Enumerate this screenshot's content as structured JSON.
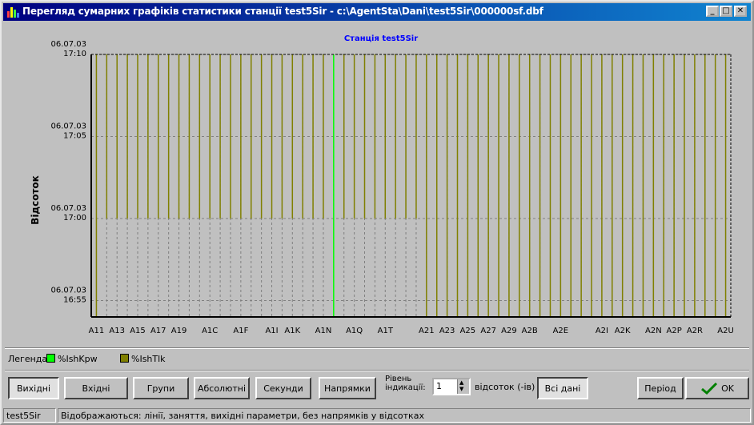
{
  "window": {
    "title": "Перегляд сумарних графіків статистики станції test5Sir - c:\\AgentSta\\Dani\\test5Sir\\000000sf.dbf",
    "controls": [
      "minimize-icon",
      "maximize-icon",
      "close-icon"
    ]
  },
  "chart_data": {
    "type": "bar",
    "title": "Станція test5Sir",
    "ylabel": "Відсоток",
    "xlabel": "",
    "y_ticks": [
      {
        "date": "06.07.03",
        "time": "16:55"
      },
      {
        "date": "06.07.03",
        "time": "17:00"
      },
      {
        "date": "06.07.03",
        "time": "17:05"
      },
      {
        "date": "06.07.03",
        "time": "17:10"
      }
    ],
    "ylim": [
      "16:54",
      "17:10"
    ],
    "grid": true,
    "x_tick_labels": [
      "A11",
      "A13",
      "A15",
      "A17",
      "A19",
      "A1C",
      "A1F",
      "A1I",
      "A1K",
      "A1N",
      "A1Q",
      "A1T",
      "A21",
      "A23",
      "A25",
      "A27",
      "A29",
      "A2B",
      "A2E",
      "A2I",
      "A2K",
      "A2N",
      "A2P",
      "A2R",
      "A2U"
    ],
    "categories": [
      "A11",
      "A12",
      "A13",
      "A14",
      "A15",
      "A16",
      "A17",
      "A18",
      "A19",
      "A1A",
      "A1B",
      "A1C",
      "A1D",
      "A1E",
      "A1F",
      "A1G",
      "A1H",
      "A1I",
      "A1J",
      "A1K",
      "A1L",
      "A1M",
      "A1N",
      "A1O",
      "A1P",
      "A1Q",
      "A1R",
      "A1S",
      "A1T",
      "A1U",
      "A1V",
      "A1W",
      "A21",
      "A22",
      "A23",
      "A24",
      "A25",
      "A26",
      "A27",
      "A28",
      "A29",
      "A2A",
      "A2B",
      "A2C",
      "A2D",
      "A2E",
      "A2F",
      "A2G",
      "A2H",
      "A2I",
      "A2J",
      "A2K",
      "A2L",
      "A2M",
      "A2N",
      "A2O",
      "A2P",
      "A2Q",
      "A2R",
      "A2S",
      "A2T",
      "A2U"
    ],
    "series": [
      {
        "name": "%IshKpw",
        "color": "#00ff00",
        "values": [
          null,
          null,
          null,
          null,
          null,
          null,
          null,
          null,
          null,
          null,
          null,
          null,
          null,
          null,
          null,
          null,
          null,
          null,
          null,
          null,
          null,
          null,
          null,
          "16:54-17:10",
          null,
          null,
          null,
          null,
          null,
          null,
          null,
          null,
          null,
          null,
          null,
          null,
          null,
          null,
          null,
          null,
          null,
          null,
          null,
          null,
          null,
          null,
          null,
          null,
          null,
          null,
          null,
          null,
          null,
          null,
          null,
          null,
          null,
          null,
          null,
          null,
          null,
          null
        ]
      },
      {
        "name": "%IshTlk",
        "color": "#808000",
        "values": [
          "16:54-17:10",
          "17:00-17:10",
          "17:00-17:10",
          "17:00-17:10",
          "17:00-17:10",
          "17:00-17:10",
          "17:00-17:10",
          "17:00-17:10",
          "17:00-17:10",
          "17:00-17:10",
          "17:00-17:10",
          "17:00-17:10",
          "17:00-17:10",
          "17:00-17:10",
          "17:00-17:10",
          "17:00-17:10",
          "17:00-17:10",
          "17:00-17:10",
          "17:00-17:10",
          "17:00-17:10",
          "17:00-17:10",
          "17:00-17:10",
          "17:00-17:10",
          null,
          "17:00-17:10",
          "17:00-17:10",
          "17:00-17:10",
          "17:00-17:10",
          "17:00-17:10",
          "17:00-17:10",
          "17:00-17:10",
          "17:00-17:10",
          "16:54-17:10",
          "16:54-17:10",
          "16:54-17:10",
          "16:54-17:10",
          "16:54-17:10",
          "16:54-17:10",
          "16:54-17:10",
          "16:54-17:10",
          "16:54-17:10",
          "16:54-17:10",
          "16:54-17:10",
          "16:54-17:10",
          "16:54-17:10",
          "16:54-17:10",
          "16:54-17:10",
          "16:54-17:10",
          "16:54-17:10",
          "16:54-17:10",
          "16:54-17:10",
          "16:54-17:10",
          "16:54-17:10",
          "16:54-17:10",
          "16:54-17:10",
          "16:54-17:10",
          "16:54-17:10",
          "16:54-17:10",
          "16:54-17:10",
          "16:54-17:10",
          "16:54-17:10",
          "16:54-17:10"
        ]
      }
    ]
  },
  "legend": {
    "label": "Легенда:",
    "items": [
      {
        "name": "%IshKpw",
        "color": "#00ff00"
      },
      {
        "name": "%IshTlk",
        "color": "#808000"
      }
    ]
  },
  "toolbar": {
    "buttons": [
      {
        "label": "Вихідні",
        "pressed": true
      },
      {
        "label": "Вхідні",
        "pressed": false
      },
      {
        "label": "Групи",
        "pressed": false
      },
      {
        "label": "Абсолютні",
        "pressed": false
      },
      {
        "label": "Секунди",
        "pressed": false
      },
      {
        "label": "Напрямки",
        "pressed": false
      }
    ],
    "level_label_line1": "Рівень",
    "level_label_line2": "індикації:",
    "level_value": "1",
    "percent_label": "відсоток (-ів)",
    "all_data_label": "Всі дані",
    "period_label": "Період",
    "ok_label": "OK"
  },
  "status": {
    "station": "test5Sir",
    "message": "Відображаються: лінії, заняття, вихідні параметри, без напрямків у відсотках"
  }
}
